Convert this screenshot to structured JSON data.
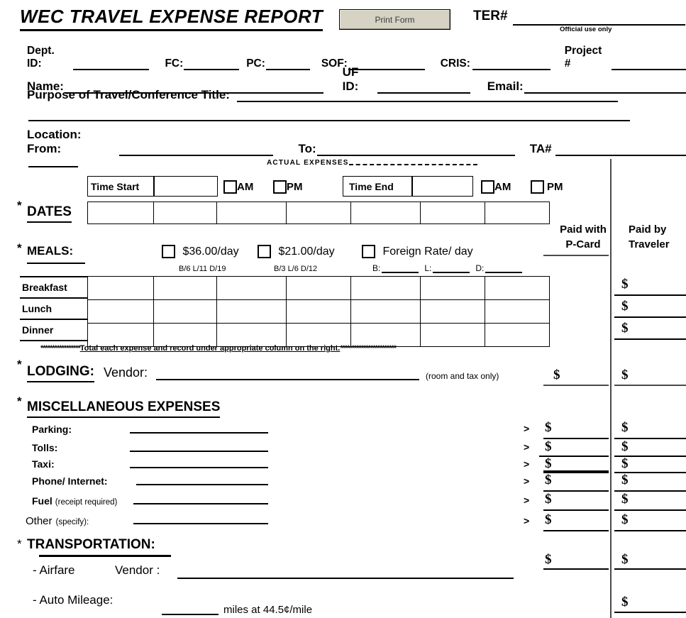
{
  "header": {
    "title": "WEC TRAVEL EXPENSE REPORT",
    "print_button": "Print Form",
    "ter_label": "TER#",
    "official_use": "Official use only"
  },
  "ids_row": [
    {
      "label": "Dept. ID:",
      "value": ""
    },
    {
      "label": "FC:",
      "value": ""
    },
    {
      "label": "PC:",
      "value": ""
    },
    {
      "label": "SOF:",
      "value": ""
    },
    {
      "label": "CRIS:",
      "value": ""
    },
    {
      "label": "Project #",
      "value": ""
    }
  ],
  "name_row": [
    {
      "label": "Name:",
      "value": ""
    },
    {
      "label": "UF ID:",
      "value": ""
    },
    {
      "label": "Email:",
      "value": ""
    }
  ],
  "purpose": {
    "label": "Purpose of Travel/Conference Title:",
    "value": "",
    "line2": ""
  },
  "location": {
    "label": "Location: From:",
    "from_value": "",
    "to_label": "To:",
    "to_value": "",
    "ta_label": "TA#",
    "ta_value": ""
  },
  "actual_expenses": {
    "heading": "ACTUAL EXPENSES",
    "time_start_label": "Time Start",
    "time_start_value": "",
    "time_end_label": "Time End",
    "time_end_value": "",
    "am_label": "AM",
    "pm_label": "PM"
  },
  "dates": {
    "label": "DATES",
    "star": "*",
    "cells": [
      "",
      "",
      "",
      "",
      "",
      "",
      ""
    ]
  },
  "paid_columns": {
    "pcard_line1": "Paid  with",
    "pcard_line2": "P-Card",
    "traveler_line1": "Paid by",
    "traveler_line2": "Traveler"
  },
  "meals": {
    "label": "MEALS:",
    "star": "*",
    "options": [
      {
        "label": "$36.00/day",
        "sub": "B/6 L/11 D/19",
        "checked": false
      },
      {
        "label": "$21.00/day",
        "sub": "B/3 L/6 D/12",
        "checked": false
      },
      {
        "label": "Foreign Rate/ day",
        "sub": "",
        "checked": false
      }
    ],
    "foreign_fields": [
      {
        "label": "B:",
        "value": ""
      },
      {
        "label": "L:",
        "value": ""
      },
      {
        "label": "D:",
        "value": ""
      }
    ],
    "rows": [
      {
        "name": "Breakfast",
        "cells": [
          "",
          "",
          "",
          "",
          "",
          "",
          ""
        ],
        "pcard": "",
        "traveler": ""
      },
      {
        "name": "Lunch",
        "cells": [
          "",
          "",
          "",
          "",
          "",
          "",
          ""
        ],
        "pcard": "",
        "traveler": ""
      },
      {
        "name": "Dinner",
        "cells": [
          "",
          "",
          "",
          "",
          "",
          "",
          ""
        ],
        "pcard": "",
        "traveler": ""
      }
    ],
    "dollar_sign": "$"
  },
  "total_note": {
    "stars_left": "*****************",
    "text": "Total  each expense  and record  under appropriate column  on the right.",
    "stars_right": "************************"
  },
  "lodging": {
    "star": "*",
    "label": "LODGING:",
    "vendor_label": "Vendor:",
    "vendor_value": "",
    "note": "(room and tax only)",
    "pcard": "",
    "traveler": ""
  },
  "misc": {
    "star": "*",
    "heading": "MISCELLANEOUS  EXPENSES",
    "arrow": ">",
    "rows": [
      {
        "label": "Parking:",
        "suffix": "",
        "value": "",
        "pcard": "",
        "traveler": "",
        "thick_rule": false
      },
      {
        "label": "Tolls:",
        "suffix": "",
        "value": "",
        "pcard": "",
        "traveler": "",
        "thick_rule": false
      },
      {
        "label": "Taxi:",
        "suffix": "",
        "value": "",
        "pcard": "",
        "traveler": "",
        "thick_rule": true
      },
      {
        "label": "Phone/ Internet:",
        "suffix": "",
        "value": "",
        "pcard": "",
        "traveler": "",
        "thick_rule": false
      },
      {
        "label": "Fuel",
        "suffix": "(receipt required)",
        "value": "",
        "pcard": "",
        "traveler": "",
        "thick_rule": false
      },
      {
        "label": "Other",
        "suffix": "(specify):",
        "value": "",
        "pcard": "",
        "traveler": "",
        "thick_rule": false
      }
    ]
  },
  "transportation": {
    "star": "*",
    "heading": "TRANSPORTATION:",
    "airfare": {
      "label": "- Airfare",
      "vendor_label": "Vendor :",
      "vendor_value": "",
      "pcard": "",
      "traveler": ""
    },
    "auto_mileage": {
      "label": "- Auto Mileage:",
      "miles_value": "",
      "rate_text": "miles at  44.5¢/mile",
      "traveler": ""
    }
  },
  "symbols": {
    "dollar": "$",
    "star": "*",
    "arrow": ">"
  }
}
